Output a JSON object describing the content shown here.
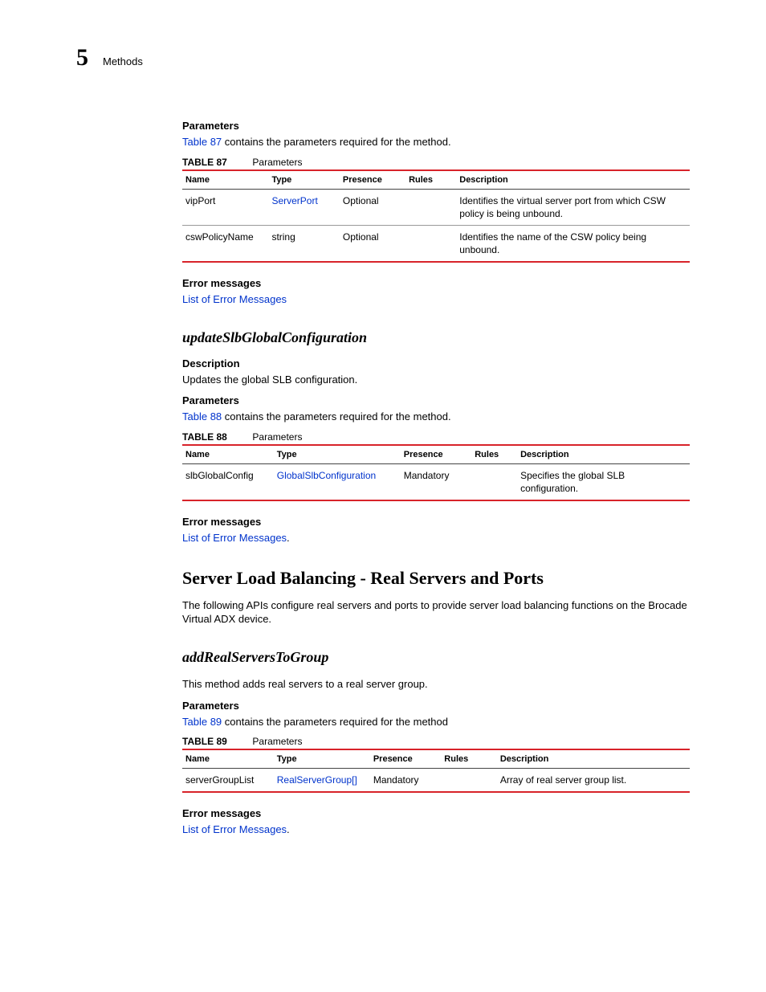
{
  "header": {
    "chapterNumber": "5",
    "chapterLabel": "Methods"
  },
  "section1": {
    "parametersLabel": "Parameters",
    "parametersIntroLink": "Table 87",
    "parametersIntroRest": " contains the parameters required for the method.",
    "table": {
      "label": "TABLE 87",
      "caption": "Parameters",
      "headers": {
        "name": "Name",
        "type": "Type",
        "presence": "Presence",
        "rules": "Rules",
        "description": "Description"
      },
      "rows": [
        {
          "name": "vipPort",
          "type": "ServerPort",
          "typeLink": true,
          "presence": "Optional",
          "rules": "",
          "description": "Identifies the virtual server port from which CSW policy is being unbound."
        },
        {
          "name": "cswPolicyName",
          "type": "string",
          "typeLink": false,
          "presence": "Optional",
          "rules": "",
          "description": "Identifies the name of the CSW policy being unbound."
        }
      ]
    },
    "errorLabel": "Error messages",
    "errorLink": "List of Error Messages"
  },
  "section2": {
    "heading": "updateSlbGlobalConfiguration",
    "descriptionLabel": "Description",
    "descriptionText": "Updates the global SLB configuration.",
    "parametersLabel": "Parameters",
    "parametersIntroLink": "Table 88",
    "parametersIntroRest": " contains the parameters required for the method.",
    "table": {
      "label": "TABLE 88",
      "caption": "Parameters",
      "headers": {
        "name": "Name",
        "type": "Type",
        "presence": "Presence",
        "rules": "Rules",
        "description": "Description"
      },
      "rows": [
        {
          "name": "slbGlobalConfig",
          "type": "GlobalSlbConfiguration",
          "typeLink": true,
          "presence": "Mandatory",
          "rules": "",
          "description": "Specifies the global SLB configuration."
        }
      ]
    },
    "errorLabel": "Error messages",
    "errorLink": "List of Error Messages",
    "errorDot": "."
  },
  "section3": {
    "heading": "Server Load Balancing - Real Servers and Ports",
    "introText": "The following APIs configure real servers and ports to provide server load balancing functions on the Brocade Virtual ADX  device."
  },
  "section4": {
    "heading": "addRealServersToGroup",
    "introText": "This method adds real servers to a real server group.",
    "parametersLabel": "Parameters",
    "parametersIntroLink": "Table 89",
    "parametersIntroRest": " contains the parameters required for the method",
    "table": {
      "label": "TABLE 89",
      "caption": "Parameters",
      "headers": {
        "name": "Name",
        "type": "Type",
        "presence": "Presence",
        "rules": "Rules",
        "description": "Description"
      },
      "rows": [
        {
          "name": "serverGroupList",
          "type": "RealServerGroup[]",
          "typeLink": true,
          "presence": "Mandatory",
          "rules": "",
          "description": "Array of real server group list."
        }
      ]
    },
    "errorLabel": "Error messages",
    "errorLink": "List of Error Messages",
    "errorDot": "."
  }
}
